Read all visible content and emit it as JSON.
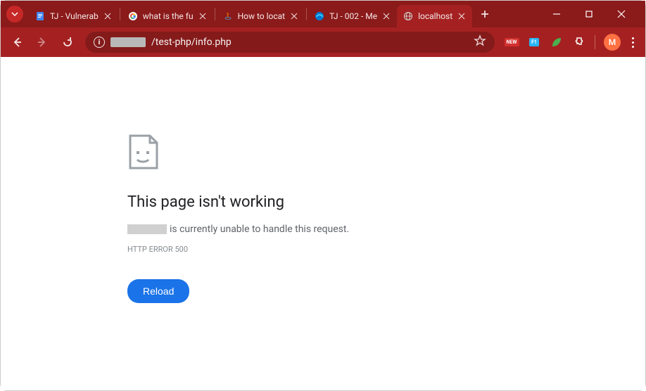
{
  "tabs": {
    "items": [
      {
        "label": "TJ - Vulnerab",
        "icon": "docs"
      },
      {
        "label": "what is the fu",
        "icon": "google"
      },
      {
        "label": "How to locat",
        "icon": "java"
      },
      {
        "label": "TJ - 002 - Me",
        "icon": "edge"
      },
      {
        "label": "localhost",
        "icon": "globe",
        "active": true
      }
    ]
  },
  "omnibox": {
    "path": "/test-php/info.php"
  },
  "avatar": {
    "initial": "M"
  },
  "ext": {
    "new_label": "NEW",
    "f1_label": "F1"
  },
  "error": {
    "title": "This page isn't working",
    "message_suffix": " is currently unable to handle this request.",
    "code": "HTTP ERROR 500",
    "reload_label": "Reload"
  }
}
